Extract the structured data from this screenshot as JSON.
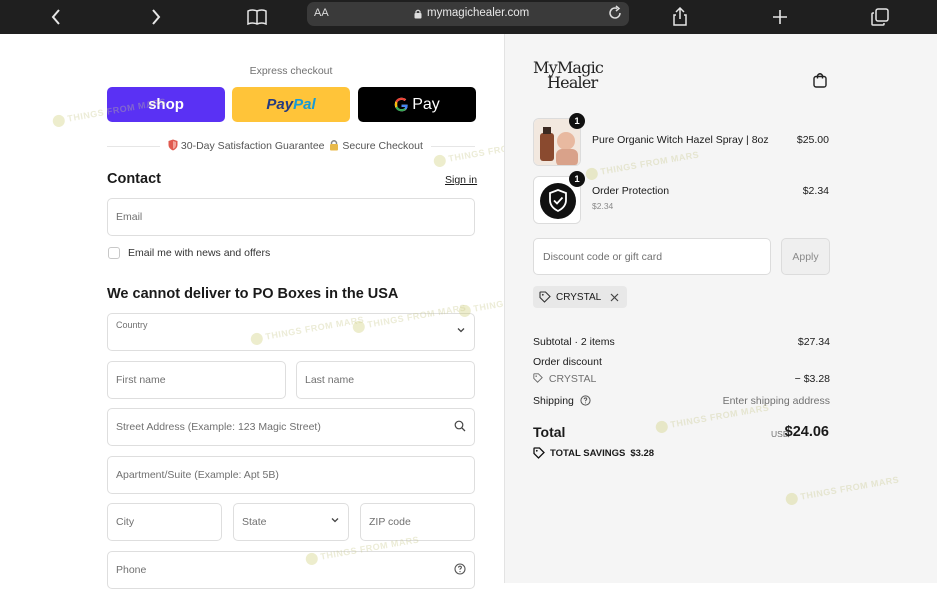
{
  "browser": {
    "url": "mymagichealer.com",
    "aa_label": "AA"
  },
  "checkout": {
    "express_title": "Express checkout",
    "shop_label": "shop",
    "paypal_label_1": "Pay",
    "paypal_label_2": "Pal",
    "gpay_label": "Pay",
    "guarantee_text": "30-Day Satisfaction Guarantee",
    "secure_text": "Secure Checkout",
    "contact_title": "Contact",
    "sign_in": "Sign in",
    "email_placeholder": "Email",
    "newsletter_label": "Email me with news and offers",
    "delivery_title": "We cannot deliver to PO Boxes in the USA",
    "country_label": "Country",
    "first_name": "First name",
    "last_name": "Last name",
    "street": "Street Address (Example: 123 Magic Street)",
    "apartment": "Apartment/Suite (Example: Apt 5B)",
    "city": "City",
    "state": "State",
    "zip": "ZIP code",
    "phone": "Phone"
  },
  "watermark": "THINGS FROM MARS",
  "summary": {
    "logo_line1": "MyMagic",
    "logo_line2": "Healer",
    "items": [
      {
        "name": "Pure Organic Witch Hazel Spray | 8oz",
        "sub": "",
        "price": "$25.00",
        "qty": "1"
      },
      {
        "name": "Order Protection",
        "sub": "$2.34",
        "price": "$2.34",
        "qty": "1"
      }
    ],
    "discount_placeholder": "Discount code or gift card",
    "apply_label": "Apply",
    "code_chip": "CRYSTAL",
    "subtotal_label": "Subtotal · 2 items",
    "subtotal_value": "$27.34",
    "order_discount_label": "Order discount",
    "discount_code": "CRYSTAL",
    "discount_value": "− $3.28",
    "shipping_label": "Shipping",
    "shipping_value": "Enter shipping address",
    "total_label": "Total",
    "total_currency": "USD",
    "total_value": "$24.06",
    "savings_label": "TOTAL SAVINGS",
    "savings_value": "$3.28"
  }
}
